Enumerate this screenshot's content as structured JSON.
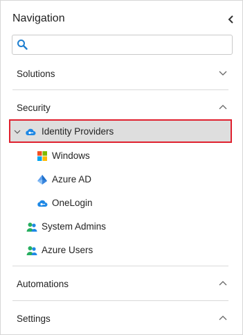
{
  "panel": {
    "title": "Navigation",
    "collapse_icon": "chevron-left-icon"
  },
  "search": {
    "icon": "search-icon",
    "value": "",
    "placeholder": ""
  },
  "sections": {
    "solutions": {
      "label": "Solutions",
      "state": "collapsed"
    },
    "security": {
      "label": "Security",
      "state": "expanded"
    },
    "automations": {
      "label": "Automations",
      "state": "expanded"
    },
    "settings": {
      "label": "Settings",
      "state": "expanded"
    }
  },
  "security_items": {
    "identity_providers": {
      "label": "Identity Providers",
      "icon": "key-cloud-icon",
      "expanded": true,
      "selected": true,
      "children": {
        "windows": {
          "label": "Windows",
          "icon": "windows-logo-icon"
        },
        "azure_ad": {
          "label": "Azure AD",
          "icon": "azure-ad-icon"
        },
        "onelogin": {
          "label": "OneLogin",
          "icon": "key-cloud-icon"
        }
      }
    },
    "system_admins": {
      "label": "System Admins",
      "icon": "users-icon"
    },
    "azure_users": {
      "label": "Azure Users",
      "icon": "users-icon"
    }
  },
  "colors": {
    "selected_background": "#dedede",
    "highlight_border": "#e0202e",
    "icon_blue": "#1e88e5",
    "users_green": "#27ae60",
    "users_blue": "#1e88e5"
  }
}
